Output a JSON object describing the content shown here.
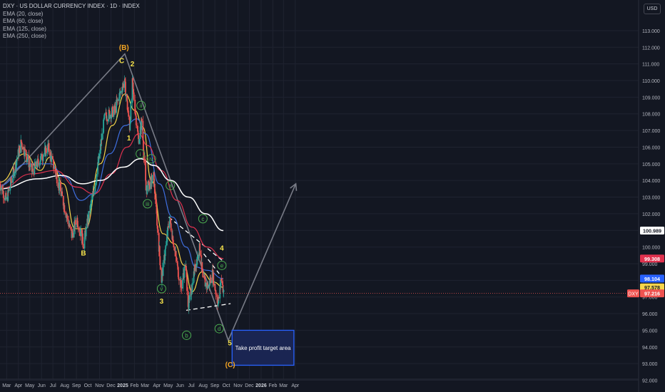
{
  "header": {
    "title": "DXY · US DOLLAR CURRENCY INDEX · 1D · INDEX",
    "indicators": [
      "EMA (20, close)",
      "EMA (60, close)",
      "EMA (125, close)",
      "EMA (250, close)"
    ],
    "currency_button": "USD"
  },
  "colors": {
    "background": "#131722",
    "grid": "#1f2330",
    "axis_text": "#b2b5be",
    "candle_up": "#26a69a",
    "candle_down": "#ef5350",
    "ema20": "#f7d54a",
    "ema60": "#3f6fe0",
    "ema125": "#e0314e",
    "ema250": "#ffffff",
    "wave_label_orange": "#f5a623",
    "wave_label_yellow": "#f7e34b",
    "circle_label": "#4caf50",
    "target_box": "#2962ff"
  },
  "chart_data": {
    "type": "candlestick",
    "symbol": "DXY",
    "ylim": [
      92,
      113
    ],
    "y_ticks": [
      "92.000",
      "93.000",
      "94.000",
      "95.000",
      "96.000",
      "97.000",
      "98.000",
      "99.000",
      "100.000",
      "101.000",
      "102.000",
      "103.000",
      "104.000",
      "105.000",
      "106.000",
      "107.000",
      "108.000",
      "109.000",
      "110.000",
      "111.000",
      "112.000",
      "113.000"
    ],
    "x_ticks": [
      "Mar",
      "Apr",
      "May",
      "Jun",
      "Jul",
      "Aug",
      "Sep",
      "Oct",
      "Nov",
      "Dec",
      "2025",
      "Feb",
      "Mar",
      "Apr",
      "May",
      "Jun",
      "Jul",
      "Aug",
      "Sep",
      "Oct",
      "Nov",
      "Dec",
      "2026",
      "Feb",
      "Mar",
      "Apr"
    ],
    "price_keypoints": [
      [
        "2024-02-20",
        103.8
      ],
      [
        "2024-03-08",
        102.8
      ],
      [
        "2024-04-16",
        106.3
      ],
      [
        "2024-05-15",
        104.5
      ],
      [
        "2024-06-26",
        106.0
      ],
      [
        "2024-07-20",
        104.1
      ],
      [
        "2024-08-27",
        100.7
      ],
      [
        "2024-09-10",
        101.7
      ],
      [
        "2024-09-27",
        100.2
      ],
      [
        "2024-10-31",
        104.2
      ],
      [
        "2024-11-22",
        107.8
      ],
      [
        "2024-12-18",
        108.2
      ],
      [
        "2025-01-13",
        110.0
      ],
      [
        "2025-01-27",
        107.2
      ],
      [
        "2025-02-03",
        109.8
      ],
      [
        "2025-02-19",
        106.4
      ],
      [
        "2025-02-28",
        107.6
      ],
      [
        "2025-03-11",
        103.4
      ],
      [
        "2025-03-31",
        104.2
      ],
      [
        "2025-04-21",
        98.0
      ],
      [
        "2025-05-12",
        101.8
      ],
      [
        "2025-06-03",
        98.6
      ],
      [
        "2025-06-12",
        97.6
      ],
      [
        "2025-06-23",
        99.0
      ],
      [
        "2025-07-01",
        96.4
      ],
      [
        "2025-07-10",
        97.6
      ],
      [
        "2025-07-18",
        98.8
      ],
      [
        "2025-07-31",
        100.0
      ],
      [
        "2025-08-08",
        98.0
      ],
      [
        "2025-08-22",
        97.6
      ],
      [
        "2025-09-02",
        98.4
      ],
      [
        "2025-09-17",
        96.6
      ],
      [
        "2025-09-26",
        98.2
      ],
      [
        "2025-10-02",
        97.2
      ]
    ],
    "ema": [
      {
        "name": "EMA (20, close)",
        "last": 97.578,
        "points": [
          [
            "2024-02-20",
            103.9
          ],
          [
            "2024-04-25",
            105.6
          ],
          [
            "2024-06-05",
            104.6
          ],
          [
            "2024-07-01",
            105.4
          ],
          [
            "2024-08-05",
            103.8
          ],
          [
            "2024-09-05",
            101.1
          ],
          [
            "2024-10-03",
            101.1
          ],
          [
            "2024-11-10",
            105.0
          ],
          [
            "2024-12-12",
            107.3
          ],
          [
            "2025-01-15",
            109.2
          ],
          [
            "2025-02-10",
            108.2
          ],
          [
            "2025-03-03",
            107.2
          ],
          [
            "2025-03-25",
            104.0
          ],
          [
            "2025-04-25",
            100.8
          ],
          [
            "2025-05-25",
            100.2
          ],
          [
            "2025-06-20",
            98.9
          ],
          [
            "2025-07-10",
            97.3
          ],
          [
            "2025-08-05",
            98.5
          ],
          [
            "2025-09-05",
            97.9
          ],
          [
            "2025-10-01",
            97.578
          ]
        ]
      },
      {
        "name": "EMA (60, close)",
        "last": 98.104,
        "points": [
          [
            "2024-02-20",
            103.7
          ],
          [
            "2024-04-30",
            105.0
          ],
          [
            "2024-06-30",
            105.0
          ],
          [
            "2024-08-10",
            104.2
          ],
          [
            "2024-09-20",
            102.8
          ],
          [
            "2024-10-25",
            103.2
          ],
          [
            "2024-12-05",
            105.6
          ],
          [
            "2025-01-15",
            107.3
          ],
          [
            "2025-02-15",
            107.7
          ],
          [
            "2025-03-10",
            106.8
          ],
          [
            "2025-04-15",
            103.8
          ],
          [
            "2025-05-20",
            101.8
          ],
          [
            "2025-06-25",
            100.0
          ],
          [
            "2025-07-20",
            98.8
          ],
          [
            "2025-08-20",
            98.6
          ],
          [
            "2025-10-01",
            98.104
          ]
        ]
      },
      {
        "name": "EMA (125, close)",
        "last": 99.308,
        "points": [
          [
            "2024-02-20",
            103.5
          ],
          [
            "2024-05-15",
            104.4
          ],
          [
            "2024-07-15",
            104.6
          ],
          [
            "2024-09-10",
            103.6
          ],
          [
            "2024-10-25",
            103.2
          ],
          [
            "2024-12-10",
            104.4
          ],
          [
            "2025-01-20",
            106.0
          ],
          [
            "2025-02-20",
            106.8
          ],
          [
            "2025-03-15",
            106.1
          ],
          [
            "2025-04-20",
            104.6
          ],
          [
            "2025-06-01",
            102.8
          ],
          [
            "2025-07-10",
            101.2
          ],
          [
            "2025-08-20",
            100.0
          ],
          [
            "2025-10-01",
            99.308
          ]
        ]
      },
      {
        "name": "EMA (250, close)",
        "last": 100.989,
        "points": [
          [
            "2024-02-20",
            103.5
          ],
          [
            "2024-06-01",
            104.1
          ],
          [
            "2024-08-01",
            104.3
          ],
          [
            "2024-09-25",
            103.8
          ],
          [
            "2024-11-10",
            104.0
          ],
          [
            "2025-01-10",
            104.8
          ],
          [
            "2025-02-25",
            105.3
          ],
          [
            "2025-04-01",
            104.9
          ],
          [
            "2025-05-15",
            104.0
          ],
          [
            "2025-07-01",
            103.0
          ],
          [
            "2025-08-15",
            102.0
          ],
          [
            "2025-10-01",
            100.989
          ]
        ]
      }
    ],
    "price_labels": [
      {
        "series": "EMA (250, close)",
        "text": "100.989",
        "value": 100.989
      },
      {
        "series": "EMA (125, close)",
        "text": "99.308",
        "value": 99.308
      },
      {
        "series": "EMA (60, close)",
        "text": "98.104",
        "value": 98.104
      },
      {
        "series": "EMA (20, close)",
        "text": "97.578",
        "value": 97.578
      },
      {
        "series": "DXY",
        "text": "97.216",
        "value": 97.216,
        "symbol": "DXY"
      }
    ],
    "drawings": {
      "gray_path": [
        [
          "2024-02-20",
          103.5
        ],
        [
          "2025-01-14",
          111.6
        ],
        [
          "2025-10-14",
          94.4
        ],
        [
          "2026-04-10",
          103.8
        ]
      ],
      "dashed_lines": [
        [
          [
            "2025-05-10",
            101.8
          ],
          [
            "2025-09-28",
            99.2
          ]
        ],
        [
          [
            "2025-06-25",
            96.2
          ],
          [
            "2025-10-20",
            96.6
          ]
        ],
        [
          [
            "2025-08-10",
            99.6
          ],
          [
            "2025-09-20",
            98.4
          ]
        ]
      ],
      "target_zone": {
        "x0": "2025-10-24",
        "x1": "2026-04-05",
        "y0": 92.9,
        "y1": 95.0,
        "label": "Take profit target area"
      }
    },
    "wave_labels": [
      {
        "text": "(B)",
        "date": "2025-01-12",
        "value": 111.85,
        "style": "orange"
      },
      {
        "text": "C",
        "date": "2025-01-06",
        "value": 111.05,
        "style": "yellow"
      },
      {
        "text": "2",
        "date": "2025-02-03",
        "value": 110.85,
        "style": "yellow"
      },
      {
        "text": "B",
        "date": "2024-09-27",
        "value": 99.5,
        "style": "yellow"
      },
      {
        "text": "1",
        "date": "2025-01-25",
        "value": 106.4,
        "style": "yellow"
      },
      {
        "text": "3",
        "date": "2025-04-21",
        "value": 96.6,
        "style": "yellow"
      },
      {
        "text": "4",
        "date": "2025-09-27",
        "value": 99.8,
        "style": "yellow"
      },
      {
        "text": "5",
        "date": "2025-10-18",
        "value": 94.1,
        "style": "yellow"
      },
      {
        "text": "(C)",
        "date": "2025-10-19",
        "value": 92.8,
        "style": "orange"
      }
    ],
    "circle_labels": [
      {
        "text": "ii",
        "date": "2025-02-26",
        "value": 108.5
      },
      {
        "text": "i",
        "date": "2025-02-24",
        "value": 105.6
      },
      {
        "text": "iv",
        "date": "2025-03-25",
        "value": 105.3
      },
      {
        "text": "iii",
        "date": "2025-03-15",
        "value": 102.6
      },
      {
        "text": "v",
        "date": "2025-04-21",
        "value": 97.5
      },
      {
        "text": "a",
        "date": "2025-05-14",
        "value": 103.7
      },
      {
        "text": "b",
        "date": "2025-06-26",
        "value": 94.7
      },
      {
        "text": "c",
        "date": "2025-08-08",
        "value": 101.7
      },
      {
        "text": "d",
        "date": "2025-09-20",
        "value": 95.1
      },
      {
        "text": "e",
        "date": "2025-09-27",
        "value": 98.9
      }
    ]
  }
}
